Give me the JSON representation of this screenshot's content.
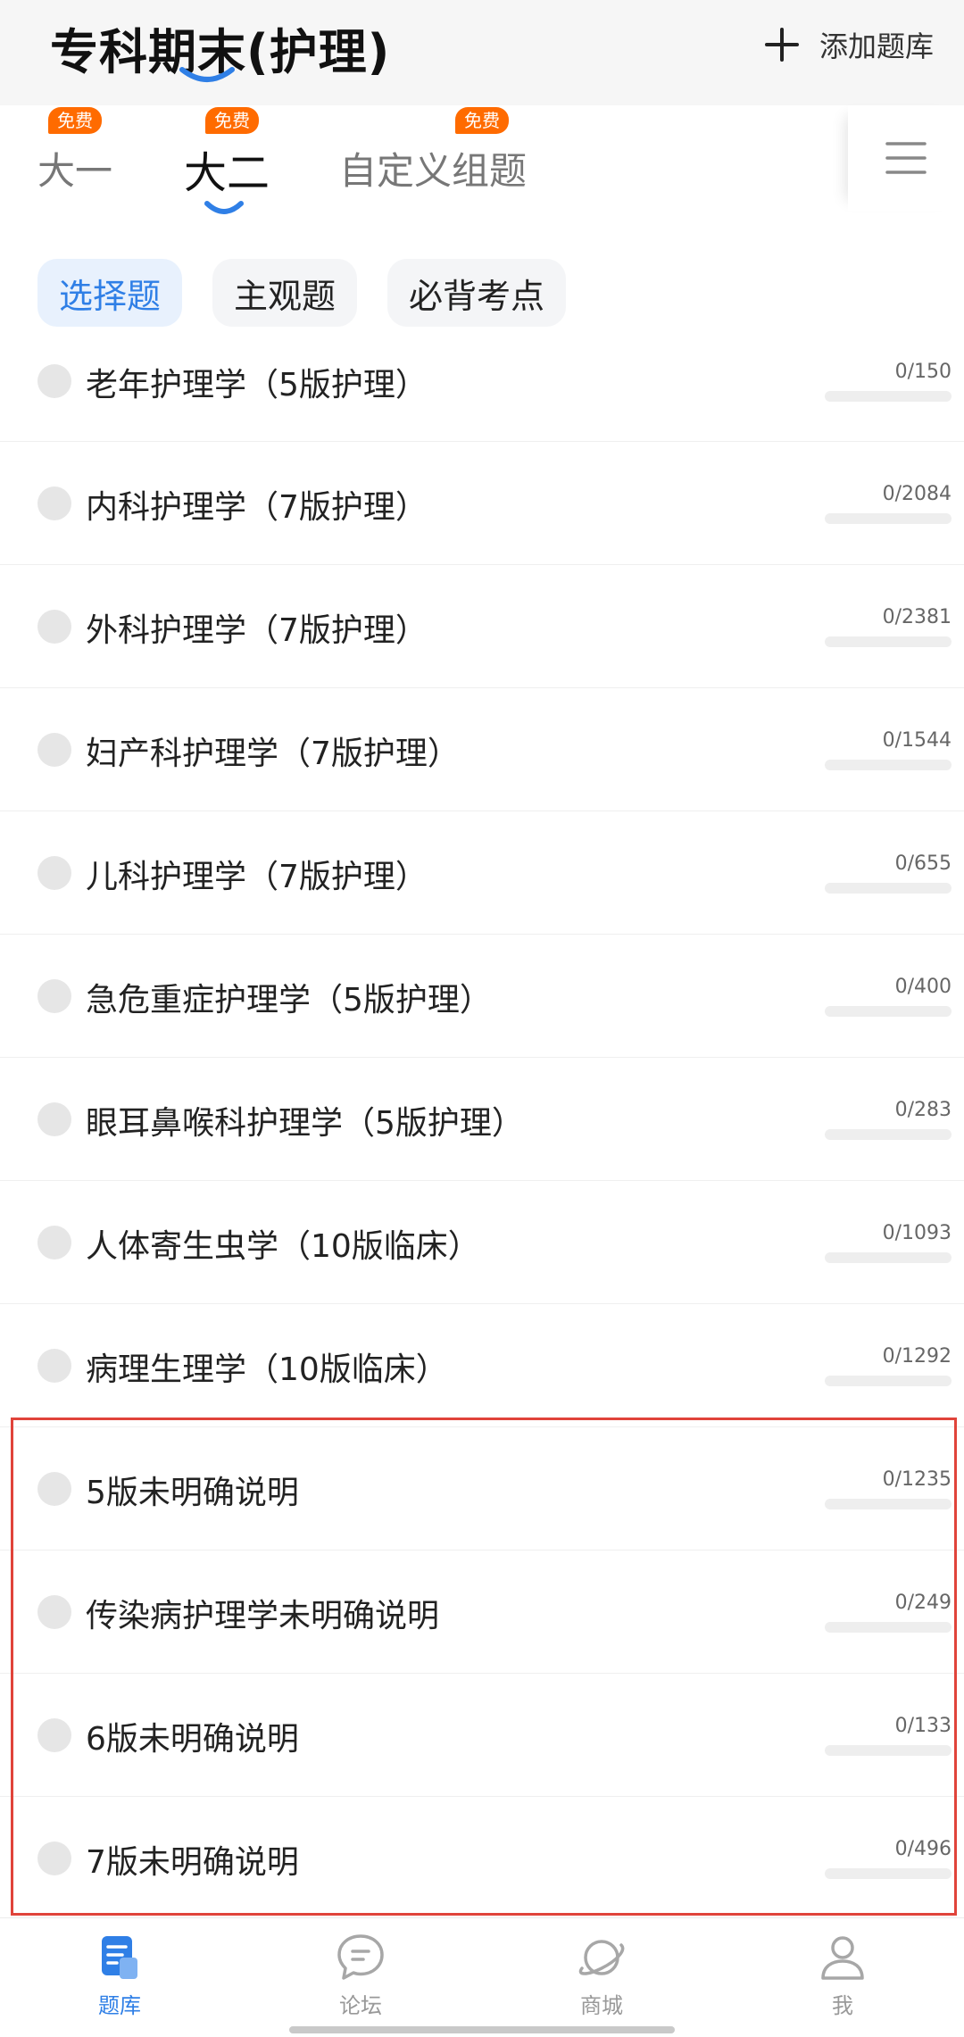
{
  "header": {
    "title": "专科期末(护理)",
    "add_label": "添加题库",
    "accent_color": "#2f7fe6"
  },
  "grade_tabs": [
    {
      "label": "大一",
      "badge": "免费",
      "active": false
    },
    {
      "label": "大二",
      "badge": "免费",
      "active": true
    },
    {
      "label": "自定义组题",
      "badge": "免费",
      "active": false
    }
  ],
  "type_chips": [
    {
      "label": "选择题",
      "active": true
    },
    {
      "label": "主观题",
      "active": false
    },
    {
      "label": "必背考点",
      "active": false
    }
  ],
  "subjects": [
    {
      "title": "老年护理学（5版护理）",
      "count": "0/150",
      "progress": 0
    },
    {
      "title": "内科护理学（7版护理）",
      "count": "0/2084",
      "progress": 0
    },
    {
      "title": "外科护理学（7版护理）",
      "count": "0/2381",
      "progress": 0
    },
    {
      "title": "妇产科护理学（7版护理）",
      "count": "0/1544",
      "progress": 0
    },
    {
      "title": "儿科护理学（7版护理）",
      "count": "0/655",
      "progress": 0
    },
    {
      "title": "急危重症护理学（5版护理）",
      "count": "0/400",
      "progress": 0
    },
    {
      "title": "眼耳鼻喉科护理学（5版护理）",
      "count": "0/283",
      "progress": 0
    },
    {
      "title": "人体寄生虫学（10版临床）",
      "count": "0/1093",
      "progress": 0
    },
    {
      "title": "病理生理学（10版临床）",
      "count": "0/1292",
      "progress": 0
    },
    {
      "title": "5版未明确说明",
      "count": "0/1235",
      "progress": 0
    },
    {
      "title": "传染病护理学未明确说明",
      "count": "0/249",
      "progress": 0
    },
    {
      "title": "6版未明确说明",
      "count": "0/133",
      "progress": 0
    },
    {
      "title": "7版未明确说明",
      "count": "0/496",
      "progress": 0
    }
  ],
  "bottom_nav": [
    {
      "label": "题库",
      "icon": "question-bank-icon",
      "active": true
    },
    {
      "label": "论坛",
      "icon": "chat-bubble-icon",
      "active": false
    },
    {
      "label": "商城",
      "icon": "planet-icon",
      "active": false
    },
    {
      "label": "我",
      "icon": "person-icon",
      "active": false
    }
  ]
}
